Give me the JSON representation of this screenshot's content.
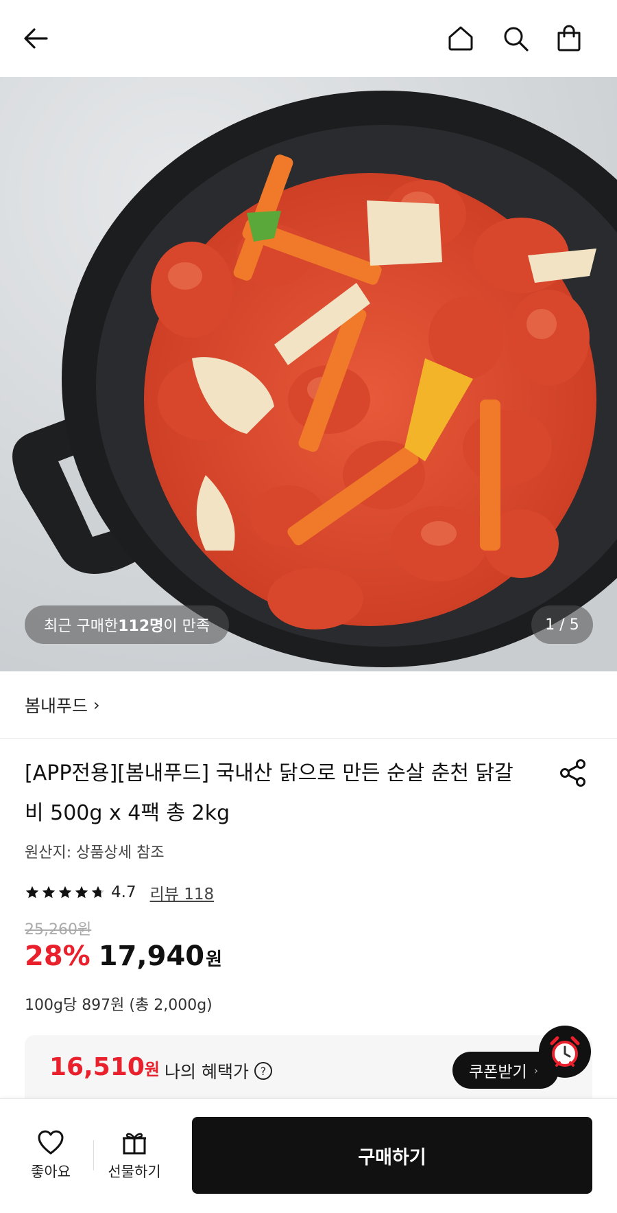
{
  "hero": {
    "buyers_prefix": "최근 구매한 ",
    "buyers_count": "112명",
    "buyers_suffix": "이 만족",
    "page_indicator": "1 / 5"
  },
  "brand": {
    "name": "봄내푸드",
    "chevron": "›"
  },
  "product": {
    "title": "[APP전용][봄내푸드] 국내산 닭으로 만든 순살 춘천 닭갈비 500g x 4팩 총 2kg",
    "origin": "원산지: 상품상세 참조",
    "rating": "4.7",
    "rating_stars": 4.7,
    "review_link": "리뷰 118",
    "original_price": "25,260원",
    "discount": "28%",
    "price": "17,940",
    "price_unit": "원",
    "unit_price": "100g당 897원 (총 2,000g)"
  },
  "benefit": {
    "price": "16,510",
    "price_unit": "원",
    "label": "나의 혜택가",
    "help_icon": "?",
    "coupon_button": "쿠폰받기",
    "coupon_chevron": "›"
  },
  "bottom_bar": {
    "like_label": "좋아요",
    "gift_label": "선물하기",
    "buy_label": "구매하기"
  },
  "icons": [
    "back-arrow-icon",
    "home-icon",
    "search-icon",
    "shopping-bag-icon",
    "share-icon",
    "star-icon",
    "question-icon",
    "alarm-clock-icon",
    "heart-icon",
    "gift-icon"
  ],
  "colors": {
    "accent_red": "#e8212d",
    "button_black": "#111111"
  }
}
